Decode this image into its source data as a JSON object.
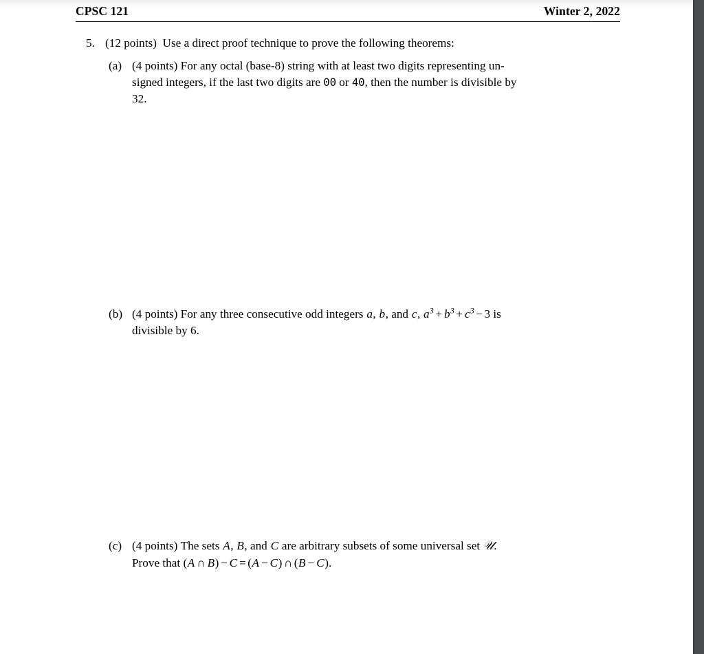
{
  "document": {
    "header": {
      "course": "CPSC 121",
      "term": "Winter 2, 2022"
    },
    "question": {
      "number": "5.",
      "points": "(12 points)",
      "prompt": "Use a direct proof technique to prove the following theorems:",
      "full_text": "5. (12 points) Use a direct proof technique to prove the following theorems:"
    },
    "subparts": [
      {
        "label": "(a)",
        "points": "(4 points)",
        "text_line1": "For any octal (base-8) string with at least two digits representing un-",
        "text_line2_a": "signed integers, if the last two digits are ",
        "digits_1": "00",
        "text_line2_b": " or ",
        "digits_2": "40",
        "text_line2_c": ", then the number is divisible by",
        "text_line3": "32.",
        "full_text": "(a) (4 points) For any octal (base-8) string with at least two digits representing unsigned integers, if the last two digits are 00 or 40, then the number is divisible by 32."
      },
      {
        "label": "(b)",
        "points": "(4 points)",
        "text_a": "For any three consecutive odd integers ",
        "var_a": "a",
        "sep_1": ", ",
        "var_b": "b",
        "sep_2": ", and ",
        "var_c": "c",
        "sep_3": ", ",
        "expr_a": "a",
        "exp_a": "3",
        "plus_1": "+",
        "expr_b": "b",
        "exp_b": "3",
        "plus_2": "+",
        "expr_c": "c",
        "exp_c": "3",
        "minus": "−",
        "three": "3",
        "text_b": " is",
        "text_line2": "divisible by 6.",
        "full_text": "(b) (4 points) For any three consecutive odd integers a, b, and c, a³ + b³ + c³ − 3 is divisible by 6."
      },
      {
        "label": "(c)",
        "points": "(4 points)",
        "text_a": "The sets ",
        "set_A": "A",
        "sep_1": ", ",
        "set_B": "B",
        "sep_2": ", and ",
        "set_C": "C",
        "text_b": " are arbitrary subsets of some universal set ",
        "universe": "𝒰",
        "period": ".",
        "text_line2_prefix": "Prove that ",
        "equation": {
          "lhs_open": "(",
          "lhs_A": "A",
          "cap_1": "∩",
          "lhs_B": "B",
          "lhs_close": ")",
          "minus_1": "−",
          "lhs_C": "C",
          "equals": "=",
          "rhs1_open": "(",
          "rhs1_A": "A",
          "minus_2": "−",
          "rhs1_C": "C",
          "rhs1_close": ")",
          "cap_2": "∩",
          "rhs2_open": "(",
          "rhs2_B": "B",
          "minus_3": "−",
          "rhs2_C": "C",
          "rhs2_close": ")",
          "period": "."
        },
        "full_text": "(c) (4 points) The sets A, B, and C are arbitrary subsets of some universal set 𝒰. Prove that (A ∩ B) − C = (A − C) ∩ (B − C)."
      }
    ]
  },
  "colors": {
    "page_background": "#ffffff",
    "text": "#000000",
    "rule": "#000000",
    "viewer_gutter": "#484d52"
  }
}
